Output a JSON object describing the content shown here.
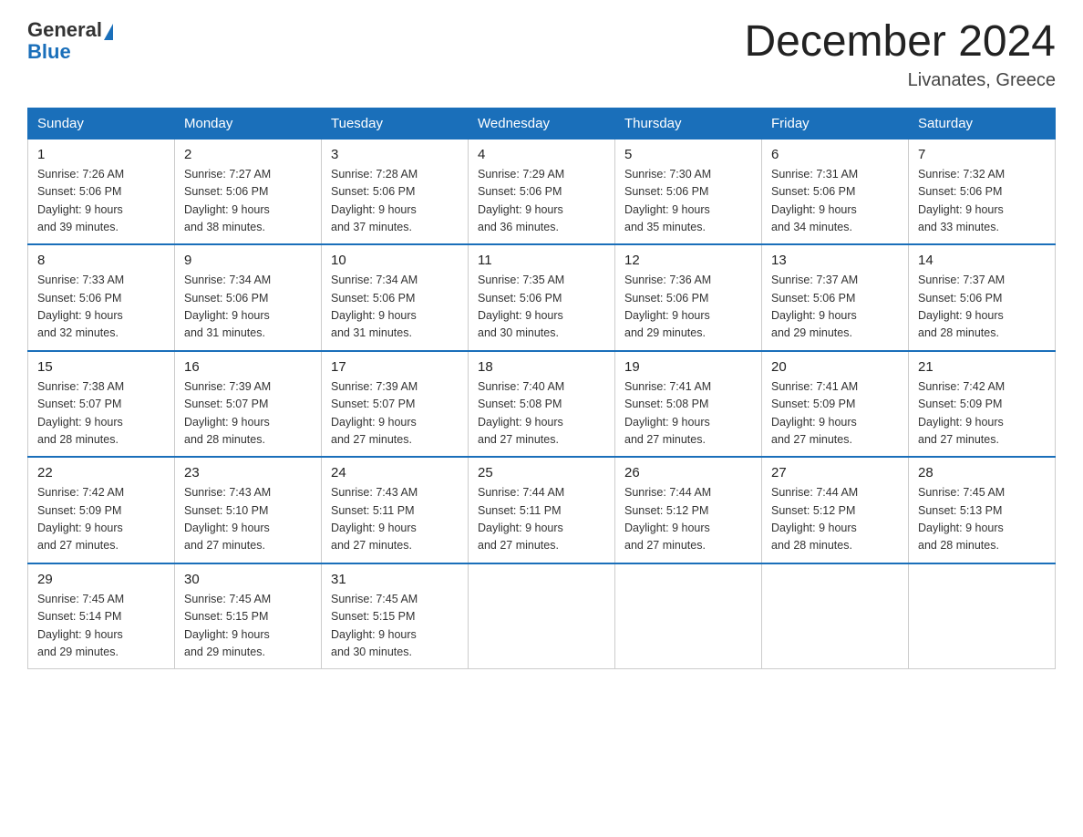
{
  "header": {
    "logo_general": "General",
    "logo_blue": "Blue",
    "month_title": "December 2024",
    "location": "Livanates, Greece"
  },
  "weekdays": [
    "Sunday",
    "Monday",
    "Tuesday",
    "Wednesday",
    "Thursday",
    "Friday",
    "Saturday"
  ],
  "weeks": [
    [
      {
        "day": "1",
        "sunrise": "7:26 AM",
        "sunset": "5:06 PM",
        "daylight": "9 hours and 39 minutes."
      },
      {
        "day": "2",
        "sunrise": "7:27 AM",
        "sunset": "5:06 PM",
        "daylight": "9 hours and 38 minutes."
      },
      {
        "day": "3",
        "sunrise": "7:28 AM",
        "sunset": "5:06 PM",
        "daylight": "9 hours and 37 minutes."
      },
      {
        "day": "4",
        "sunrise": "7:29 AM",
        "sunset": "5:06 PM",
        "daylight": "9 hours and 36 minutes."
      },
      {
        "day": "5",
        "sunrise": "7:30 AM",
        "sunset": "5:06 PM",
        "daylight": "9 hours and 35 minutes."
      },
      {
        "day": "6",
        "sunrise": "7:31 AM",
        "sunset": "5:06 PM",
        "daylight": "9 hours and 34 minutes."
      },
      {
        "day": "7",
        "sunrise": "7:32 AM",
        "sunset": "5:06 PM",
        "daylight": "9 hours and 33 minutes."
      }
    ],
    [
      {
        "day": "8",
        "sunrise": "7:33 AM",
        "sunset": "5:06 PM",
        "daylight": "9 hours and 32 minutes."
      },
      {
        "day": "9",
        "sunrise": "7:34 AM",
        "sunset": "5:06 PM",
        "daylight": "9 hours and 31 minutes."
      },
      {
        "day": "10",
        "sunrise": "7:34 AM",
        "sunset": "5:06 PM",
        "daylight": "9 hours and 31 minutes."
      },
      {
        "day": "11",
        "sunrise": "7:35 AM",
        "sunset": "5:06 PM",
        "daylight": "9 hours and 30 minutes."
      },
      {
        "day": "12",
        "sunrise": "7:36 AM",
        "sunset": "5:06 PM",
        "daylight": "9 hours and 29 minutes."
      },
      {
        "day": "13",
        "sunrise": "7:37 AM",
        "sunset": "5:06 PM",
        "daylight": "9 hours and 29 minutes."
      },
      {
        "day": "14",
        "sunrise": "7:37 AM",
        "sunset": "5:06 PM",
        "daylight": "9 hours and 28 minutes."
      }
    ],
    [
      {
        "day": "15",
        "sunrise": "7:38 AM",
        "sunset": "5:07 PM",
        "daylight": "9 hours and 28 minutes."
      },
      {
        "day": "16",
        "sunrise": "7:39 AM",
        "sunset": "5:07 PM",
        "daylight": "9 hours and 28 minutes."
      },
      {
        "day": "17",
        "sunrise": "7:39 AM",
        "sunset": "5:07 PM",
        "daylight": "9 hours and 27 minutes."
      },
      {
        "day": "18",
        "sunrise": "7:40 AM",
        "sunset": "5:08 PM",
        "daylight": "9 hours and 27 minutes."
      },
      {
        "day": "19",
        "sunrise": "7:41 AM",
        "sunset": "5:08 PM",
        "daylight": "9 hours and 27 minutes."
      },
      {
        "day": "20",
        "sunrise": "7:41 AM",
        "sunset": "5:09 PM",
        "daylight": "9 hours and 27 minutes."
      },
      {
        "day": "21",
        "sunrise": "7:42 AM",
        "sunset": "5:09 PM",
        "daylight": "9 hours and 27 minutes."
      }
    ],
    [
      {
        "day": "22",
        "sunrise": "7:42 AM",
        "sunset": "5:09 PM",
        "daylight": "9 hours and 27 minutes."
      },
      {
        "day": "23",
        "sunrise": "7:43 AM",
        "sunset": "5:10 PM",
        "daylight": "9 hours and 27 minutes."
      },
      {
        "day": "24",
        "sunrise": "7:43 AM",
        "sunset": "5:11 PM",
        "daylight": "9 hours and 27 minutes."
      },
      {
        "day": "25",
        "sunrise": "7:44 AM",
        "sunset": "5:11 PM",
        "daylight": "9 hours and 27 minutes."
      },
      {
        "day": "26",
        "sunrise": "7:44 AM",
        "sunset": "5:12 PM",
        "daylight": "9 hours and 27 minutes."
      },
      {
        "day": "27",
        "sunrise": "7:44 AM",
        "sunset": "5:12 PM",
        "daylight": "9 hours and 28 minutes."
      },
      {
        "day": "28",
        "sunrise": "7:45 AM",
        "sunset": "5:13 PM",
        "daylight": "9 hours and 28 minutes."
      }
    ],
    [
      {
        "day": "29",
        "sunrise": "7:45 AM",
        "sunset": "5:14 PM",
        "daylight": "9 hours and 29 minutes."
      },
      {
        "day": "30",
        "sunrise": "7:45 AM",
        "sunset": "5:15 PM",
        "daylight": "9 hours and 29 minutes."
      },
      {
        "day": "31",
        "sunrise": "7:45 AM",
        "sunset": "5:15 PM",
        "daylight": "9 hours and 30 minutes."
      },
      null,
      null,
      null,
      null
    ]
  ],
  "labels": {
    "sunrise_prefix": "Sunrise: ",
    "sunset_prefix": "Sunset: ",
    "daylight_prefix": "Daylight: "
  }
}
